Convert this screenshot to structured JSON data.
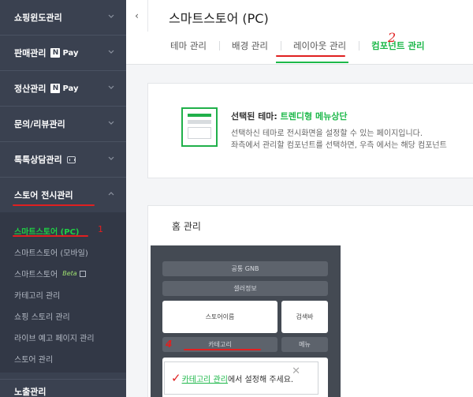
{
  "sidebar": {
    "items": [
      {
        "label": "쇼핑윈도관리"
      },
      {
        "label": "판매관리",
        "badge_n": "N",
        "badge_pay": "Pay"
      },
      {
        "label": "정산관리",
        "badge_n": "N",
        "badge_pay": "Pay"
      },
      {
        "label": "문의/리뷰관리"
      },
      {
        "label": "톡톡상담관리"
      },
      {
        "label": "스토어 전시관리"
      }
    ],
    "submenu": [
      {
        "label": "스마트스토어 (PC)"
      },
      {
        "label": "스마트스토어 (모바일)"
      },
      {
        "label": "스마트스토어",
        "beta": "Beta"
      },
      {
        "label": "카테고리 관리"
      },
      {
        "label": "쇼핑 스토리 관리"
      },
      {
        "label": "라이브 예고 페이지 관리"
      },
      {
        "label": "스토어 관리"
      }
    ],
    "bottom_item": "노출관리",
    "annotation_1": "1"
  },
  "header": {
    "collapse_icon": "‹",
    "title": "스마트스토어 (PC)",
    "tabs": [
      {
        "label": "테마 관리"
      },
      {
        "label": "배경 관리"
      },
      {
        "label": "레이아웃 관리"
      },
      {
        "label": "컴포넌트 관리"
      }
    ],
    "annotation_2": "2"
  },
  "theme": {
    "label_prefix": "선택된 테마: ",
    "name": "트렌디형 메뉴상단",
    "desc_line1": "선택하신 테마로 전시화면을 설정할 수 있는 페이지입니다.",
    "desc_line2": "좌측에서 관리할 컴포넌트를 선택하면, 우측 에서는 해당 컴포넌트"
  },
  "home": {
    "title": "홈 관리",
    "blocks": {
      "gnb": "공통 GNB",
      "seller": "셀러정보",
      "store_name": "스토어이름",
      "search": "검색바",
      "category": "카테고리",
      "menu": "메뉴"
    },
    "annotation_4": "4",
    "tooltip": {
      "check": "✓",
      "link": "카테고리 관리",
      "rest": "에서 설정해 주세요.",
      "close": "✕"
    }
  },
  "colors": {
    "sidebar_bg": "#3a4150",
    "accent_green": "#1db84a",
    "annotation_red": "#e02020"
  }
}
